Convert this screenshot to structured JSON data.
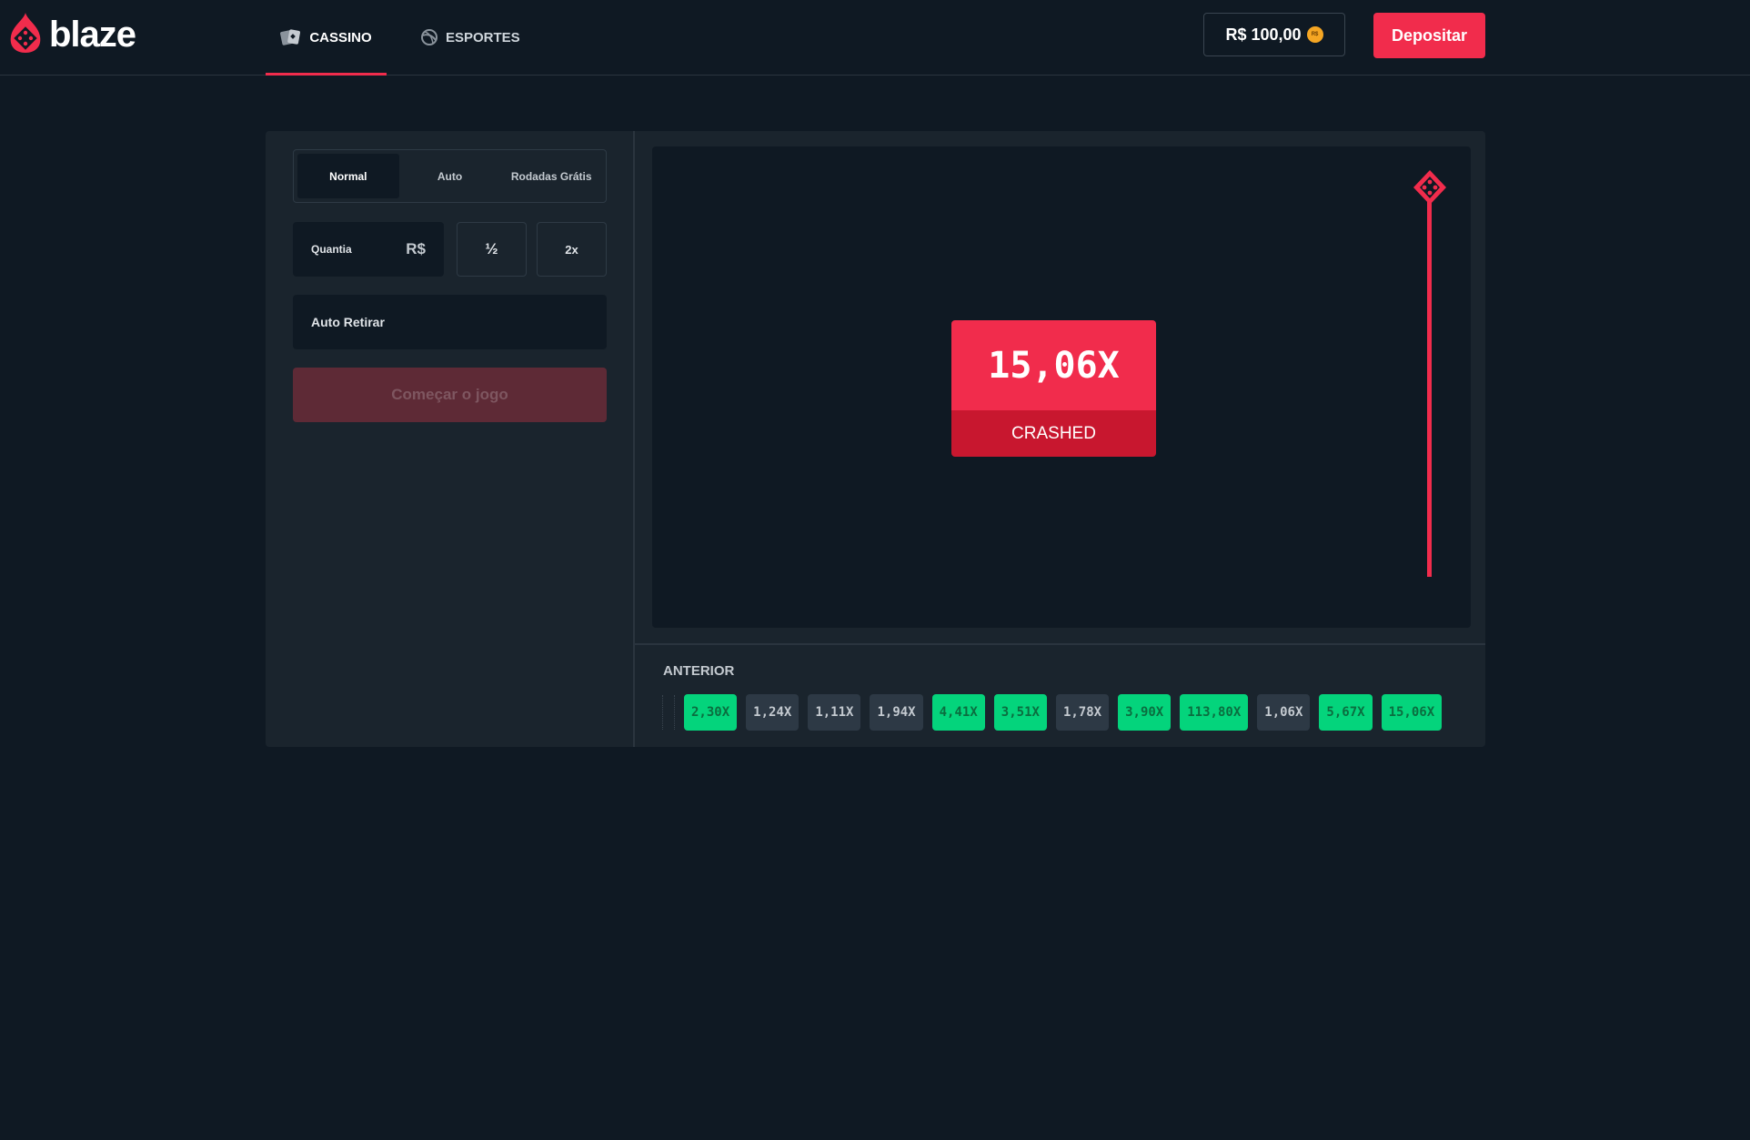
{
  "brand": {
    "name": "blaze",
    "accent": "#f12c4c"
  },
  "nav": {
    "cassino": {
      "label": "CASSINO",
      "icon": "cards-icon"
    },
    "esportes": {
      "label": "ESPORTES",
      "icon": "ball-icon"
    }
  },
  "wallet": {
    "balance": "R$ 100,00",
    "coin_label": "R$",
    "deposit_label": "Depositar"
  },
  "controls": {
    "modes": [
      {
        "label": "Normal",
        "active": true
      },
      {
        "label": "Auto",
        "active": false
      },
      {
        "label": "Rodadas Grátis",
        "active": false
      }
    ],
    "amount_label": "Quantia",
    "currency": "R$",
    "half_label": "½",
    "double_label": "2x",
    "auto_cashout_label": "Auto Retirar",
    "start_label": "Começar o jogo"
  },
  "round": {
    "multiplier": "15,06X",
    "status": "CRASHED"
  },
  "history": {
    "title": "ANTERIOR",
    "items": [
      {
        "value": "2,30X",
        "result": "green"
      },
      {
        "value": "1,24X",
        "result": "gray"
      },
      {
        "value": "1,11X",
        "result": "gray"
      },
      {
        "value": "1,94X",
        "result": "gray"
      },
      {
        "value": "4,41X",
        "result": "green"
      },
      {
        "value": "3,51X",
        "result": "green"
      },
      {
        "value": "1,78X",
        "result": "gray"
      },
      {
        "value": "3,90X",
        "result": "green"
      },
      {
        "value": "113,80X",
        "result": "green"
      },
      {
        "value": "1,06X",
        "result": "gray"
      },
      {
        "value": "5,67X",
        "result": "green"
      },
      {
        "value": "15,06X",
        "result": "green"
      }
    ]
  }
}
